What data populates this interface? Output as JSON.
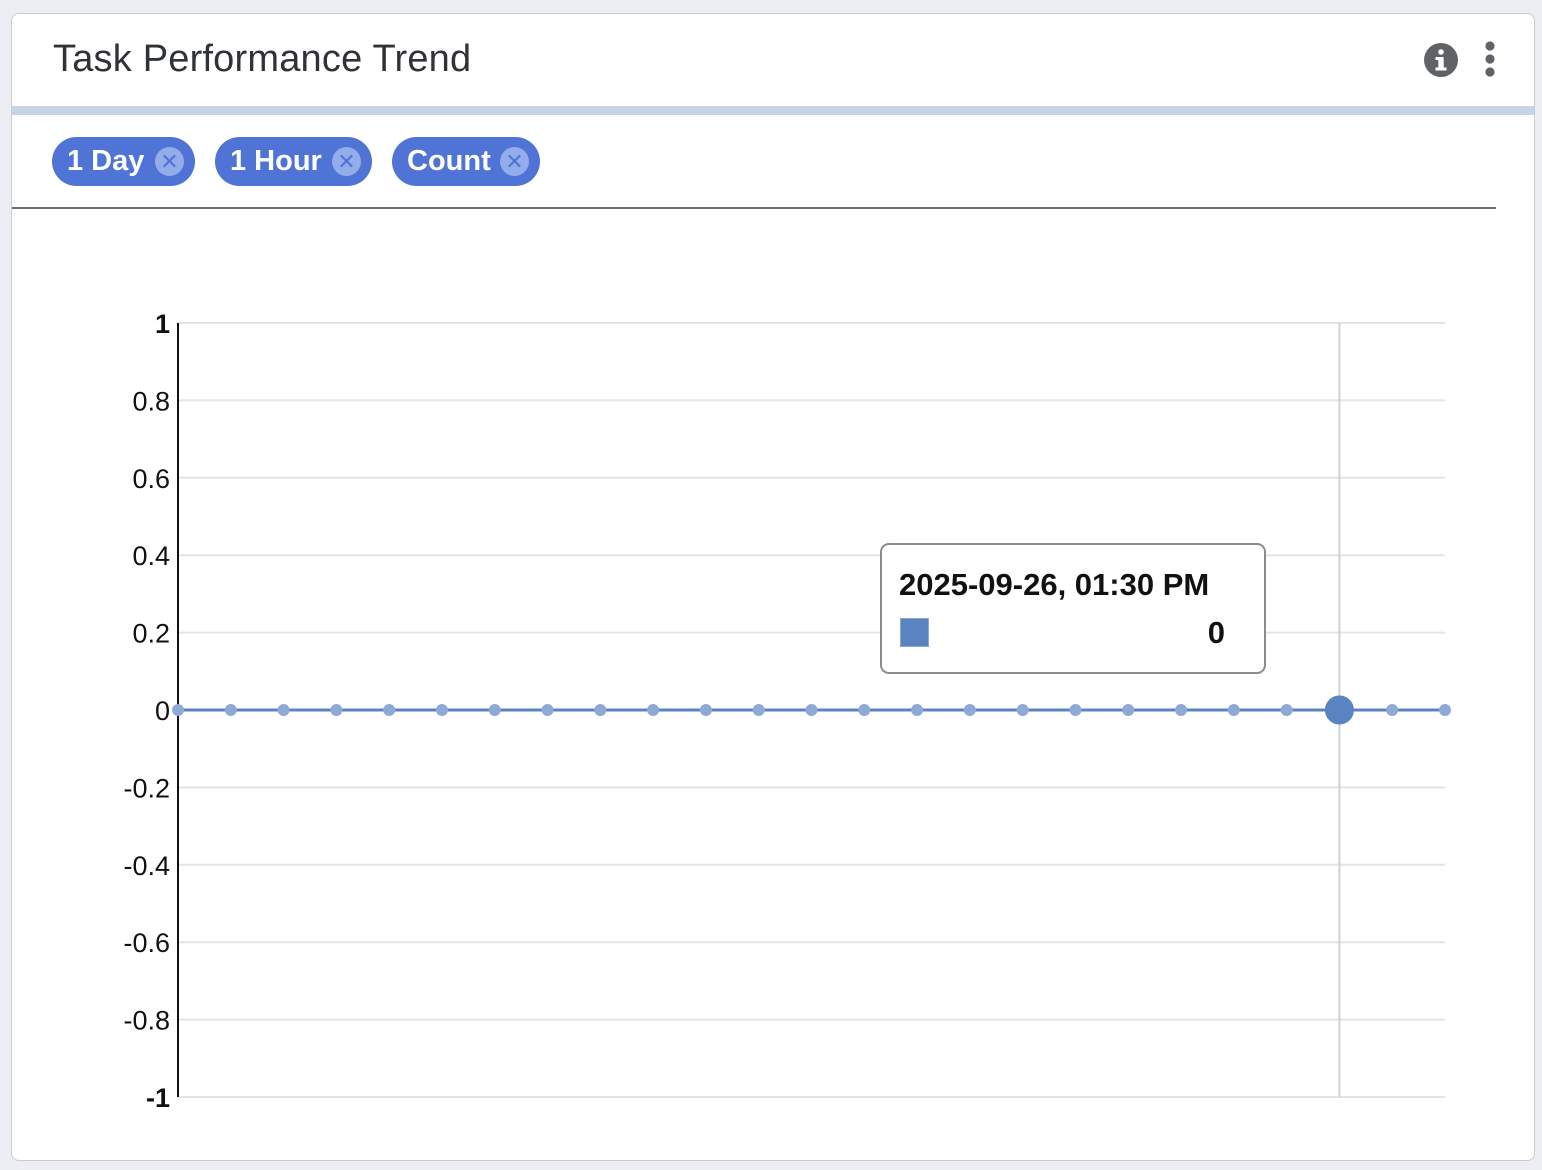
{
  "header": {
    "title": "Task Performance Trend",
    "info_icon": "info-circle-icon",
    "more_icon": "vertical-dots-icon"
  },
  "filters": [
    {
      "label": "1 Day",
      "close_icon": "close-circle-icon"
    },
    {
      "label": "1 Hour",
      "close_icon": "close-circle-icon"
    },
    {
      "label": "Count",
      "close_icon": "close-circle-icon"
    }
  ],
  "colors": {
    "accent": "#4f74d6",
    "series": "#5a84c0",
    "title": "#2f3237"
  },
  "tooltip": {
    "title": "2025-09-26, 01:30 PM",
    "value": "0"
  },
  "chart_data": {
    "type": "line",
    "title": "",
    "xlabel": "",
    "ylabel": "",
    "ylim": [
      -1,
      1
    ],
    "y_ticks": [
      "1",
      "0.8",
      "0.6",
      "0.4",
      "0.2",
      "0",
      "-0.2",
      "-0.4",
      "-0.6",
      "-0.8",
      "-1"
    ],
    "grid": true,
    "legend": "none",
    "series": [
      {
        "values": [
          0,
          0,
          0,
          0,
          0,
          0,
          0,
          0,
          0,
          0,
          0,
          0,
          0,
          0,
          0,
          0,
          0,
          0,
          0,
          0,
          0,
          0,
          0,
          0,
          0
        ]
      }
    ],
    "highlighted_index": 22
  }
}
